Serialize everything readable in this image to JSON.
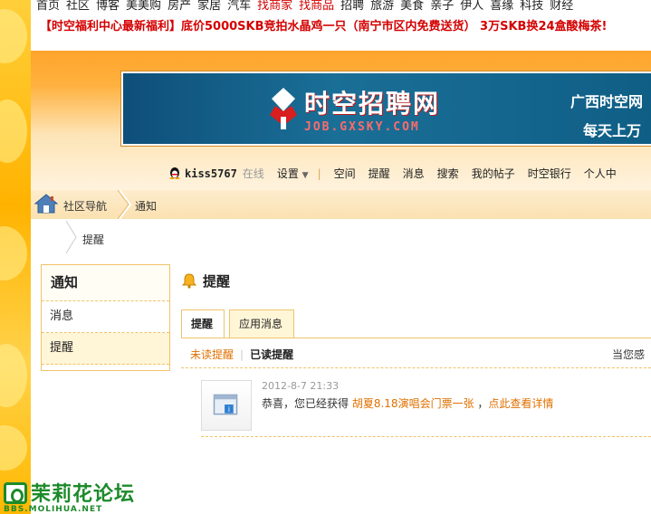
{
  "topnav": [
    "首页",
    "社区",
    "博客",
    "美美购",
    "房产",
    "家居",
    "汽车",
    "找商家",
    "找商品",
    "招聘",
    "旅游",
    "美食",
    "亲子",
    "伊人",
    "喜缘",
    "科技",
    "财经"
  ],
  "topnav_red": [
    "找商家",
    "找商品"
  ],
  "announcement": "【时空福利中心最新福利】底价5000SKB竞拍水晶鸡一只（南宁市区内免费送货） 3万SKB换24盒酸梅茶!",
  "banner": {
    "brand": "时空招聘网",
    "domain": "JOB.GXSKY.COM",
    "right_line1": "广西时空网",
    "right_line2": "每天上万"
  },
  "userbar": {
    "username": "kiss5767",
    "status": "在线",
    "settings": "设置",
    "items": [
      "空间",
      "提醒",
      "消息",
      "搜索",
      "我的帖子",
      "时空银行",
      "个人中"
    ]
  },
  "breadcrumb": {
    "root": "社区导航",
    "current": "通知",
    "sub": "提醒"
  },
  "sidebar": {
    "header": "通知",
    "items": [
      "消息",
      "提醒"
    ]
  },
  "main": {
    "title": "提醒",
    "tabs": [
      "提醒",
      "应用消息"
    ],
    "filter_unread": "未读提醒",
    "filter_read": "已读提醒",
    "filter_right": "当您感"
  },
  "notice": {
    "time": "2012-8-7 21:33",
    "prefix": "恭喜，您已经获得",
    "prize": "胡夏8.18演唱会门票一张",
    "sep": "，",
    "detail_link": "点此查看详情"
  },
  "watermark": {
    "main": "茉莉花论坛",
    "sub": "BBS.MOLIHUA.NET"
  },
  "colors": {
    "accent_orange": "#ffb13f",
    "link_orange": "#e07000",
    "announce_red": "#d40000",
    "border_gold": "#f0c36a",
    "watermark_green": "#1d8a2a"
  }
}
